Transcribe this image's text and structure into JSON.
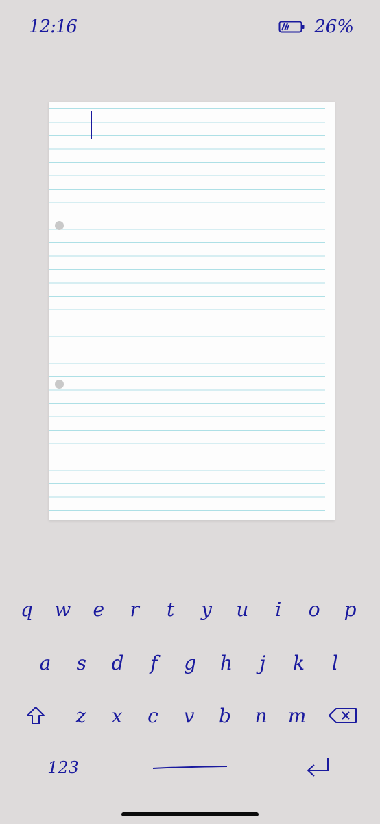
{
  "status_bar": {
    "time": "12:16",
    "battery_percent": "26%",
    "battery_level": 0.26,
    "battery_icon": "battery-icon"
  },
  "paper": {
    "text": ""
  },
  "keyboard": {
    "row1": [
      "q",
      "w",
      "e",
      "r",
      "t",
      "y",
      "u",
      "i",
      "o",
      "p"
    ],
    "row2": [
      "a",
      "s",
      "d",
      "f",
      "g",
      "h",
      "j",
      "k",
      "l"
    ],
    "row3": [
      "z",
      "x",
      "c",
      "v",
      "b",
      "n",
      "m"
    ],
    "numbers_label": "123",
    "icons": {
      "shift": "shift-icon",
      "backspace": "backspace-icon",
      "space": "space-bar",
      "return": "return-icon"
    }
  },
  "colors": {
    "background": "#dedbdb",
    "ink": "#1a1a9e",
    "paper": "#fdfdfd",
    "ruling": "#aee0e6",
    "margin": "#e3a3ad"
  }
}
